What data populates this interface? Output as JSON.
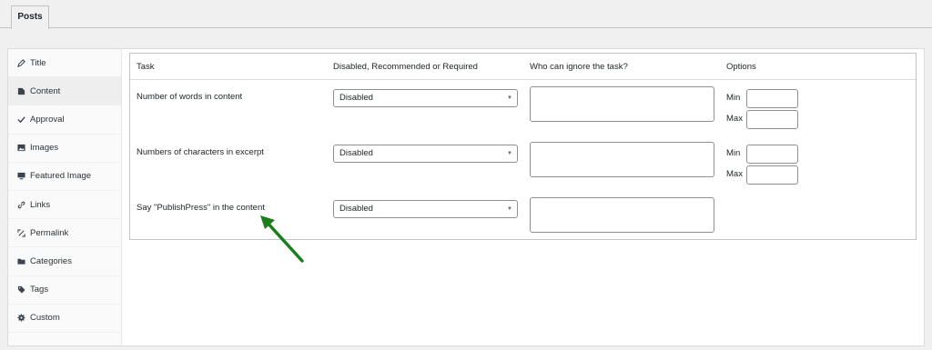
{
  "tabs": {
    "posts": "Posts"
  },
  "sidebar": {
    "items": [
      {
        "label": "Title",
        "icon": "pencil-icon"
      },
      {
        "label": "Content",
        "icon": "document-icon"
      },
      {
        "label": "Approval",
        "icon": "checkmark-icon"
      },
      {
        "label": "Images",
        "icon": "image-icon"
      },
      {
        "label": "Featured Image",
        "icon": "monitor-icon"
      },
      {
        "label": "Links",
        "icon": "link-icon"
      },
      {
        "label": "Permalink",
        "icon": "permalink-icon"
      },
      {
        "label": "Categories",
        "icon": "folder-icon"
      },
      {
        "label": "Tags",
        "icon": "tag-icon"
      },
      {
        "label": "Custom",
        "icon": "gear-icon"
      }
    ],
    "active": "Content"
  },
  "table": {
    "headers": {
      "task": "Task",
      "rule": "Disabled, Recommended or Required",
      "ignore": "Who can ignore the task?",
      "options": "Options"
    },
    "rows": [
      {
        "task": "Number of words in content",
        "rule": "Disabled",
        "min_label": "Min",
        "max_label": "Max"
      },
      {
        "task": "Numbers of characters in excerpt",
        "rule": "Disabled",
        "min_label": "Min",
        "max_label": "Max"
      },
      {
        "task": "Say \"PublishPress\" in the content",
        "rule": "Disabled"
      }
    ]
  },
  "colors": {
    "arrow": "#1a7f1a",
    "border": "#8c8f94"
  }
}
